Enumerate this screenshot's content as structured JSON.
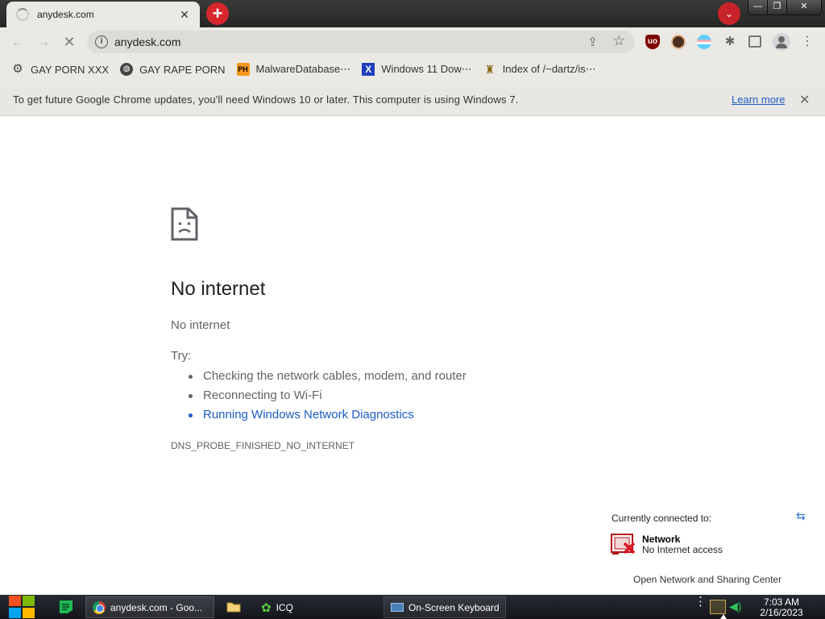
{
  "browser": {
    "tab": {
      "title": "anydesk.com",
      "close": "✕"
    },
    "new_tab": "+",
    "tab_search": "⌄",
    "window_controls": {
      "minimize": "—",
      "maximize": "❐",
      "close": "✕"
    },
    "nav": {
      "back": "←",
      "forward": "→",
      "stop": "✕"
    },
    "omnibox": {
      "info": "i",
      "url": "anydesk.com",
      "share": "⇪",
      "star": "☆"
    },
    "extensions": {
      "ublock": "uo",
      "puzzle": "✱"
    },
    "menu": "⋮"
  },
  "bookmarks": [
    {
      "icon": "gear-icon",
      "glyph": "⚙",
      "label": "GAY PORN XXX"
    },
    {
      "icon": "globe-icon",
      "glyph": "◍",
      "label": "GAY RAPE PORN"
    },
    {
      "icon": "ph-icon",
      "glyph": "PH",
      "label": "MalwareDatabase⋯"
    },
    {
      "icon": "x-icon",
      "glyph": "X",
      "label": "Windows 11 Dow⋯"
    },
    {
      "icon": "index-icon",
      "glyph": "♜",
      "label": "Index of /~dartz/is⋯"
    }
  ],
  "infobar": {
    "message": "To get future Google Chrome updates, you'll need Windows 10 or later. This computer is using Windows 7.",
    "learn_more": "Learn more",
    "close": "✕"
  },
  "error_page": {
    "title": "No internet",
    "subtitle": "No internet",
    "try_label": "Try:",
    "suggestions": [
      "Checking the network cables, modem, and router",
      "Reconnecting to Wi-Fi",
      "Running Windows Network Diagnostics"
    ],
    "error_code": "DNS_PROBE_FINISHED_NO_INTERNET"
  },
  "network_flyout": {
    "header": "Currently connected to:",
    "refresh": "⇆",
    "network_name": "Network",
    "network_status": "No Internet access",
    "link": "Open Network and Sharing Center"
  },
  "taskbar": {
    "items": [
      {
        "label": "anydesk.com - Goo..."
      },
      {
        "label": "ICQ"
      },
      {
        "label": "On-Screen Keyboard"
      }
    ],
    "tray_dots": "⋮",
    "volume": "◀)",
    "time": "7:03 AM",
    "date": "2/16/2023"
  },
  "colors": {
    "accent_red": "#d7262e",
    "link_blue": "#1a5cc7",
    "taskbar": "#1a1d23"
  }
}
